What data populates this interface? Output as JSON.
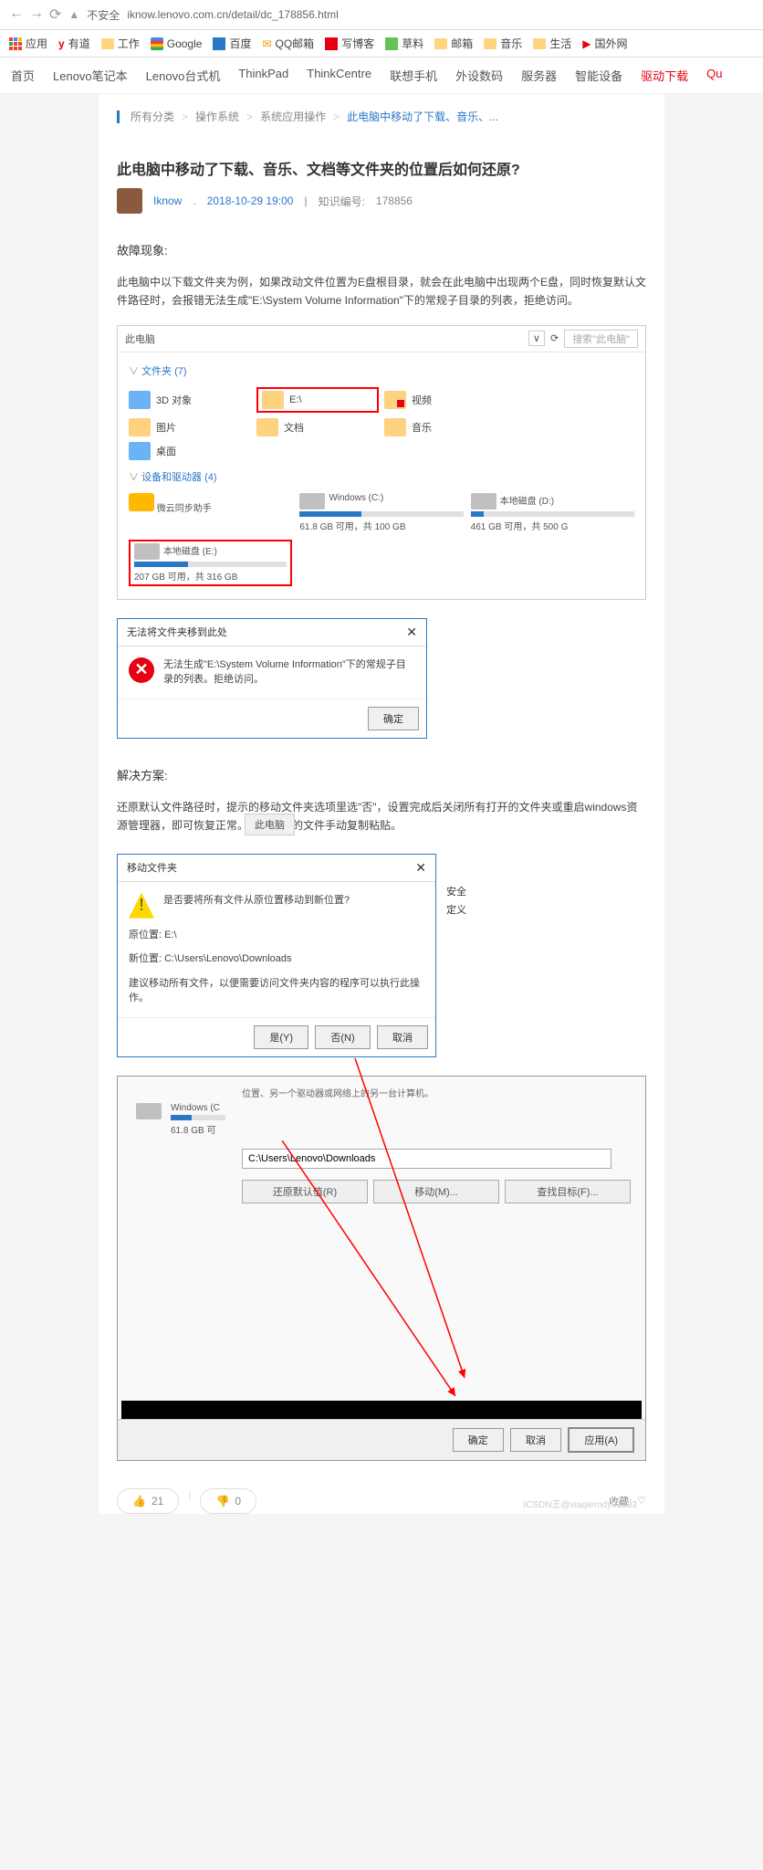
{
  "browser": {
    "security": "不安全",
    "url": "iknow.lenovo.com.cn/detail/dc_178856.html"
  },
  "bookmarks": {
    "apps": "应用",
    "items": [
      "有道",
      "工作",
      "Google",
      "百度",
      "QQ邮箱",
      "写博客",
      "草料",
      "邮箱",
      "音乐",
      "生活",
      "国外网"
    ]
  },
  "siteNav": [
    "首页",
    "Lenovo笔记本",
    "Lenovo台式机",
    "ThinkPad",
    "ThinkCentre",
    "联想手机",
    "外设数码",
    "服务器",
    "智能设备",
    "驱动下载",
    "Qu"
  ],
  "breadcrumb": {
    "all": "所有分类",
    "os": "操作系统",
    "sysop": "系统应用操作",
    "current": "此电脑中移动了下载、音乐、..."
  },
  "article": {
    "title": "此电脑中移动了下载、音乐、文档等文件夹的位置后如何还原?",
    "author": "Iknow",
    "date": "2018-10-29 19:00",
    "idLabel": "知识编号:",
    "id": "178856",
    "faultLabel": "故障现象:",
    "faultText": "此电脑中以下载文件夹为例，如果改动文件位置为E盘根目录，就会在此电脑中出现两个E盘，同时恢复默认文件路径时，会报错无法生成\"E:\\System Volume Information\"下的常规子目录的列表，拒绝访问。",
    "solutionLabel": "解决方案:",
    "solutionText": "还原默认文件路径时，提示的移动文件夹选项里选\"否\"，设置完成后关闭所有打开的文件夹或重启windows资源管理器，即可恢复正常。需要移动的文件手动复制粘贴。"
  },
  "explorer": {
    "pcLabel": "此电脑",
    "searchPlaceholder": "搜索\"此电脑\"",
    "foldersLabel": "文件夹 (7)",
    "folders": {
      "obj3d": "3D 对象",
      "e_drive": "E:\\",
      "video": "视频",
      "pictures": "图片",
      "docs": "文档",
      "music": "音乐",
      "desktop": "桌面"
    },
    "devicesLabel": "设备和驱动器 (4)",
    "drives": {
      "cloud": "微云同步助手",
      "c_name": "Windows (C:)",
      "c_info": "61.8 GB 可用，共 100 GB",
      "d_name": "本地磁盘 (D:)",
      "d_info": "461 GB 可用，共 500 G",
      "e_name": "本地磁盘 (E:)",
      "e_info": "207 GB 可用，共 316 GB"
    }
  },
  "errorDialog": {
    "title": "无法将文件夹移到此处",
    "msg": "无法生成\"E:\\System Volume Information\"下的常规子目录的列表。拒绝访问。",
    "ok": "确定"
  },
  "moveDialog": {
    "title": "移动文件夹",
    "question": "是否要将所有文件从原位置移动到新位置?",
    "origLabel": "原位置: E:\\",
    "newLabel": "新位置: C:\\Users\\Lenovo\\Downloads",
    "hint": "建议移动所有文件，以便需要访问文件夹内容的程序可以执行此操作。",
    "yes": "是(Y)",
    "no": "否(N)",
    "cancel": "取消"
  },
  "props": {
    "tabs": {
      "thispc": "此电脑",
      "security": "安全",
      "custom": "定义"
    },
    "desc": "位置、另一个驱动器或网络上的另一台计算机。",
    "path": "C:\\Users\\Lenovo\\Downloads",
    "restore": "还原默认值(R)",
    "move": "移动(M)...",
    "find": "查找目标(F)...",
    "ok": "确定",
    "cancel": "取消",
    "apply": "应用(A)",
    "drive_c": "Windows (C",
    "drive_c_info": "61.8 GB 可"
  },
  "footer": {
    "up": "21",
    "down": "0",
    "collect": "收藏:",
    "watermark": "ICSDN王@xiaqierody01233"
  }
}
